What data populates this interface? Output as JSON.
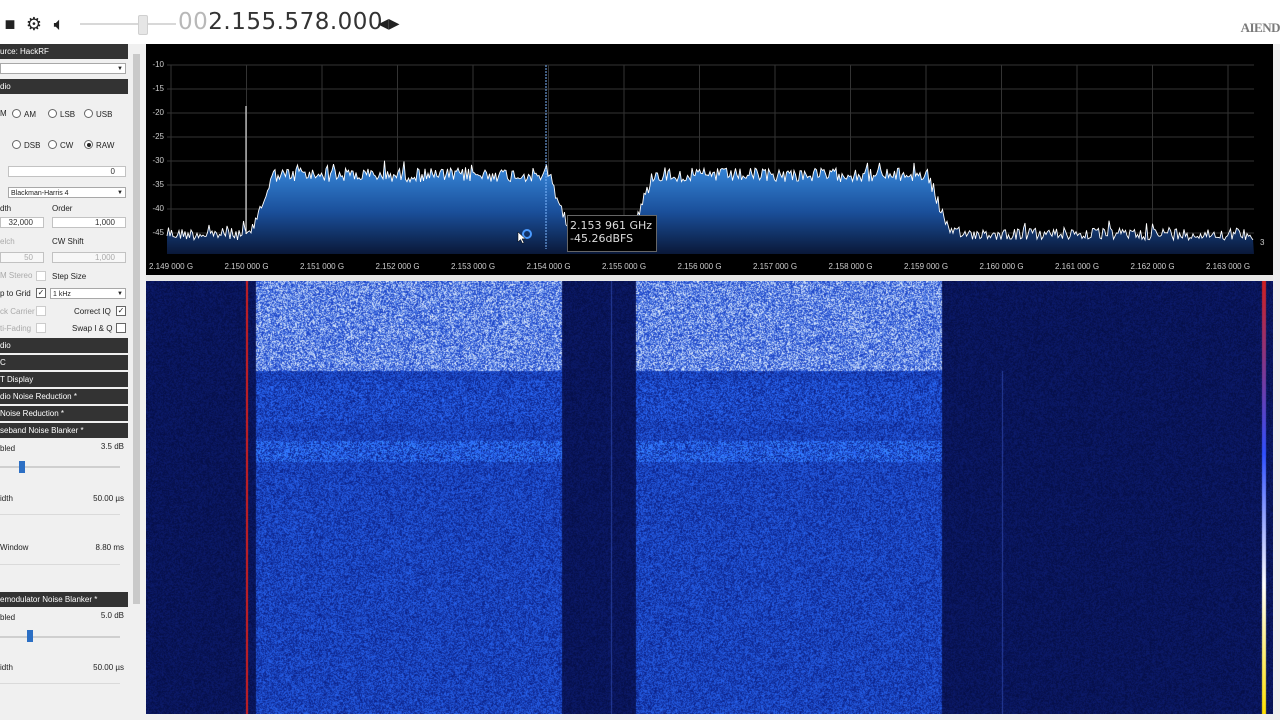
{
  "toolbar": {
    "frequency_prefix": "00",
    "frequency_main": "2.155.578.000",
    "stop_icon": "stop-icon",
    "gear_icon": "gear-icon",
    "speaker_icon": "speaker-icon",
    "arrows_icon": "left-right-arrows-icon",
    "logo_text": "AIEND"
  },
  "panel": {
    "source_header": "urce: HackRF",
    "source_value": "",
    "radio_header": "dio",
    "modes_row1": [
      {
        "label": "AM",
        "selected": false
      },
      {
        "label": "LSB",
        "selected": false
      },
      {
        "label": "USB",
        "selected": false
      }
    ],
    "modes_row2": [
      {
        "label": "DSB",
        "selected": false
      },
      {
        "label": "CW",
        "selected": false
      },
      {
        "label": "RAW",
        "selected": true
      }
    ],
    "modes_prefix1": "M",
    "shift_value": "0",
    "window_value": "Blackman-Harris 4",
    "filter_width_label": "dth",
    "order_label": "Order",
    "width_value": "32,000",
    "order_value": "1,000",
    "squelch_label": "elch",
    "cw_shift_label": "CW Shift",
    "squelch_value": "50",
    "cw_shift_value": "1,000",
    "fm_stereo_label": "M Stereo",
    "step_size_label": "Step Size",
    "snap_label": "p to Grid",
    "step_value": "1 kHz",
    "lock_carrier_label": "ck Carrier",
    "correct_iq_label": "Correct IQ",
    "anti_fading_label": "ti-Fading",
    "swap_iq_label": "Swap I & Q",
    "sections": [
      "dio",
      "C",
      "T Display",
      "dio Noise Reduction *",
      "Noise Reduction *",
      "seband Noise Blanker *"
    ],
    "nb1_enabled_label": "bled",
    "nb1_threshold": "3.5 dB",
    "nb1_threshold_level": 0.18,
    "nb1_width_label": "idth",
    "nb1_width_value": "50.00 µs",
    "nb1_window_label": "Window",
    "nb1_window_value": "8.80 ms",
    "nb2_header": "emodulator Noise Blanker *",
    "nb2_enabled_label": "bled",
    "nb2_threshold": "5.0 dB",
    "nb2_threshold_level": 0.25,
    "nb2_width_label": "idth",
    "nb2_width_value": "50.00 µs"
  },
  "spectrum": {
    "y_ticks": [
      "-10",
      "-15",
      "-20",
      "-25",
      "-30",
      "-35",
      "-40",
      "-45"
    ],
    "x_ticks": [
      "2.149 000 G",
      "2.150 000 G",
      "2.151 000 G",
      "2.152 000 G",
      "2.153 000 G",
      "2.154 000 G",
      "2.155 000 G",
      "2.156 000 G",
      "2.157 000 G",
      "2.158 000 G",
      "2.159 000 G",
      "2.160 000 G",
      "2.161 000 G",
      "2.162 000 G",
      "2.163 000 G"
    ],
    "tooltip_freq": "2.153 961 GHz",
    "tooltip_level": "-45.26dBFS",
    "side_number": "3",
    "colors": {
      "trace": "#ffffff",
      "fill_top": "#2f7fd6",
      "fill_bottom": "#0a1a40",
      "grid": "#3a3a3a",
      "marker": "#7fb8ff"
    }
  },
  "waterfall": {
    "colors": {
      "background": "#07125a",
      "signal": "#1d3fd8",
      "bright": "#bfe0ff",
      "marker": "#d02020"
    }
  }
}
